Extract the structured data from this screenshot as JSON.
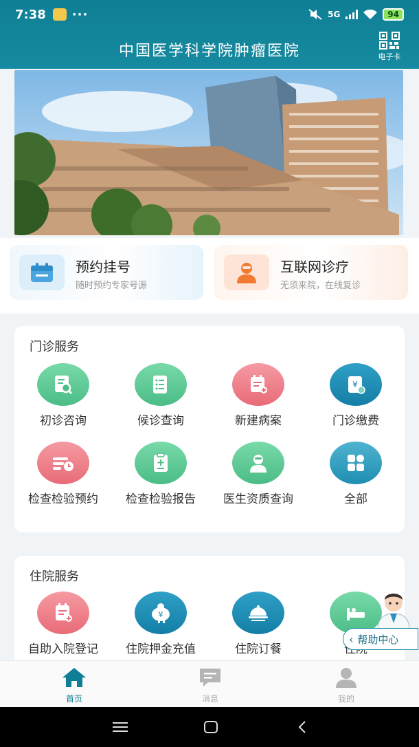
{
  "status_bar": {
    "time": "7:38",
    "dots": "···",
    "network": "5G",
    "battery": "94"
  },
  "header": {
    "title": "中国医学科学院肿瘤医院",
    "ecard_label": "电子卡"
  },
  "quick_actions": [
    {
      "title": "预约挂号",
      "subtitle": "随时预约专家号源"
    },
    {
      "title": "互联网诊疗",
      "subtitle": "无须来院，在线复诊"
    }
  ],
  "outpatient": {
    "title": "门诊服务",
    "items": [
      {
        "label": "初诊咨询",
        "icon": "search-doc-icon"
      },
      {
        "label": "候诊查询",
        "icon": "list-doc-icon"
      },
      {
        "label": "新建病案",
        "icon": "add-record-icon"
      },
      {
        "label": "门诊缴费",
        "icon": "payment-icon"
      },
      {
        "label": "检查检验预约",
        "icon": "schedule-icon"
      },
      {
        "label": "检查检验报告",
        "icon": "report-icon"
      },
      {
        "label": "医生资质查询",
        "icon": "doctor-icon"
      },
      {
        "label": "全部",
        "icon": "grid-icon"
      }
    ]
  },
  "inpatient": {
    "title": "住院服务",
    "items": [
      {
        "label": "自助入院登记",
        "icon": "register-icon"
      },
      {
        "label": "住院押金充值",
        "icon": "piggy-bank-icon"
      },
      {
        "label": "住院订餐",
        "icon": "meal-icon"
      },
      {
        "label": "住院",
        "icon": "bed-icon"
      }
    ]
  },
  "help": {
    "label": "帮助中心"
  },
  "tabs": [
    {
      "label": "首页"
    },
    {
      "label": "消息"
    },
    {
      "label": "我的"
    }
  ]
}
